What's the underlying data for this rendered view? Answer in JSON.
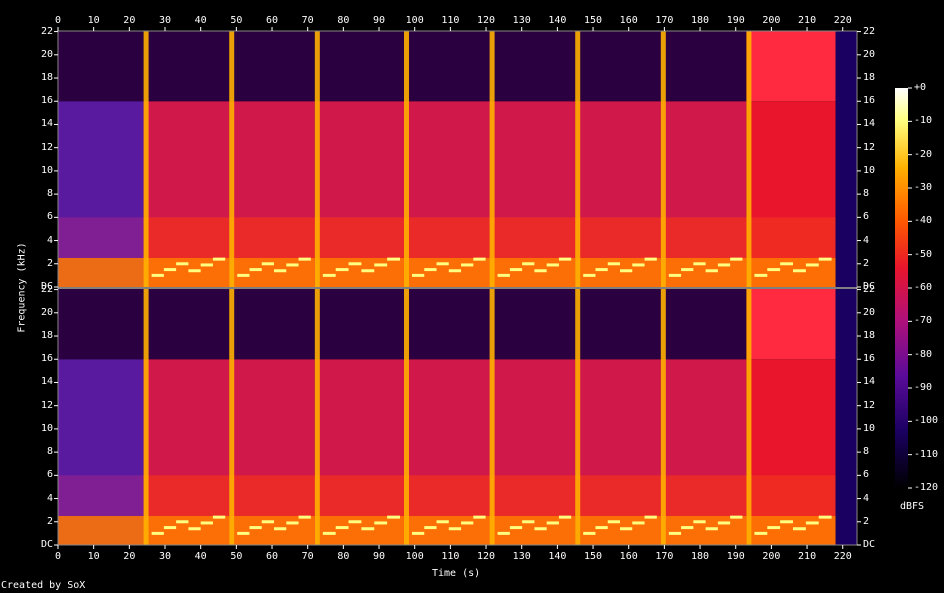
{
  "chart_data": {
    "type": "heatmap",
    "title": "",
    "xlabel": "Time (s)",
    "ylabel": "Frequency (kHz)",
    "xlim": [
      0,
      224
    ],
    "ylim": [
      0,
      22.05
    ],
    "x_ticks": [
      "0",
      "10",
      "20",
      "30",
      "40",
      "50",
      "60",
      "70",
      "80",
      "90",
      "100",
      "110",
      "120",
      "130",
      "140",
      "150",
      "160",
      "170",
      "180",
      "190",
      "200",
      "210",
      "220"
    ],
    "y_ticks": [
      "DC",
      "2",
      "4",
      "6",
      "8",
      "10",
      "12",
      "14",
      "16",
      "18",
      "20",
      "22"
    ],
    "channels": 2,
    "colorbar": {
      "label": "dBFS",
      "ticks": [
        "+0",
        "-10",
        "-20",
        "-30",
        "-40",
        "-50",
        "-60",
        "-70",
        "-80",
        "-90",
        "-100",
        "-110",
        "-120"
      ],
      "range": [
        -120,
        0
      ]
    },
    "segment_boundaries_s": [
      24,
      48,
      72,
      97,
      121,
      145,
      169,
      193,
      218
    ],
    "lowpass_cutoff_khz": 16,
    "footer": "Created by SoX",
    "colors": {
      "background": "#000000",
      "text": "#ffffff",
      "palette": [
        "#000000",
        "#1a0060",
        "#5a0b9a",
        "#b0107a",
        "#e8152c",
        "#ff5a00",
        "#ffb000",
        "#ffff80",
        "#ffffff"
      ]
    }
  }
}
